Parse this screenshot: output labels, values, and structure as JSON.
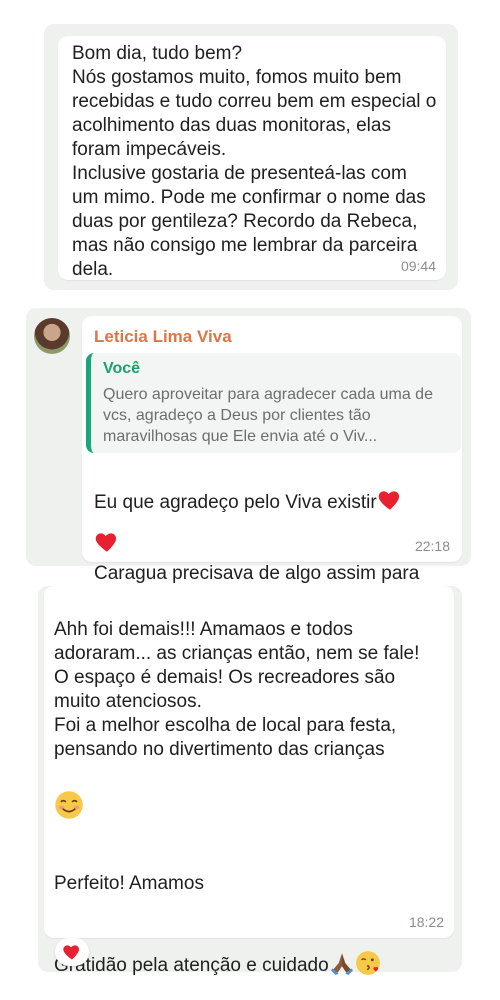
{
  "messages": [
    {
      "text": "Bom dia, tudo bem?\nNós gostamos muito, fomos muito bem recebidas e tudo correu bem em especial o acolhimento das duas monitoras, elas foram impecáveis.\nInclusive gostaria de presenteá-las com um mimo. Pode me confirmar o nome das duas por gentileza? Recordo da Rebeca, mas não consigo me lembrar da parceira dela.",
      "time": "09:44"
    },
    {
      "sender": "Leticia Lima Viva",
      "quote_author": "Você",
      "quote_text": "Quero aproveitar para agradecer cada uma de vcs, agradeço a Deus por clientes tão maravilhosas que Ele envia até o Viv...",
      "line1": "Eu que agradeço pelo Viva existir",
      "line2": "Caragua precisava de algo assim para nossos pequenos.",
      "time": "22:18"
    },
    {
      "para1": "Ahh foi demais!!! Amamaos e todos adoraram... as crianças então, nem se fale!\nO espaço é demais! Os recreadores são muito atenciosos.\nFoi a melhor escolha de local para festa, pensando no divertimento das crianças",
      "para2": "Perfeito! Amamos",
      "para3": "Gratidão pela atenção e cuidado",
      "time": "18:22",
      "reaction": "heart"
    }
  ],
  "icons": {
    "heart": "heart-icon",
    "smile": "smiling-face-icon",
    "pray": "folded-hands-icon",
    "kiss": "face-blowing-kiss-icon"
  },
  "colors": {
    "sender": "#d9774a",
    "quote_accent": "#18a36a",
    "heart": "#e8202f",
    "card_bg": "#eef1ee"
  }
}
